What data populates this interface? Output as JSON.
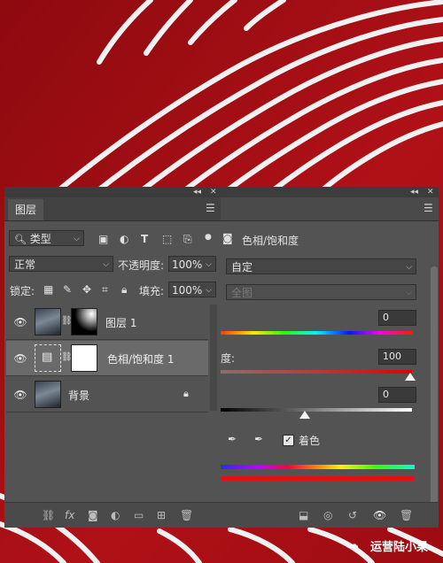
{
  "layers_panel": {
    "tab_label": "图层",
    "filter_kind": "类型",
    "blend_mode": "正常",
    "opacity_label": "不透明度:",
    "opacity_value": "100%",
    "lock_label": "锁定:",
    "fill_label": "填充:",
    "fill_value": "100%",
    "layers": [
      {
        "name": "图层 1"
      },
      {
        "name": "色相/饱和度 1"
      },
      {
        "name": "背景"
      }
    ]
  },
  "properties_panel": {
    "title": "色相/饱和度",
    "preset": "自定",
    "channel": "全图",
    "hue_value": "0",
    "saturation_label": "度:",
    "saturation_value": "100",
    "lightness_value": "0",
    "colorize_label": "着色"
  },
  "watermark": {
    "text": "运营陆小果"
  },
  "colors": {
    "panel": "#535353",
    "panel_dark": "#424242",
    "background_red": "#a30d12"
  }
}
